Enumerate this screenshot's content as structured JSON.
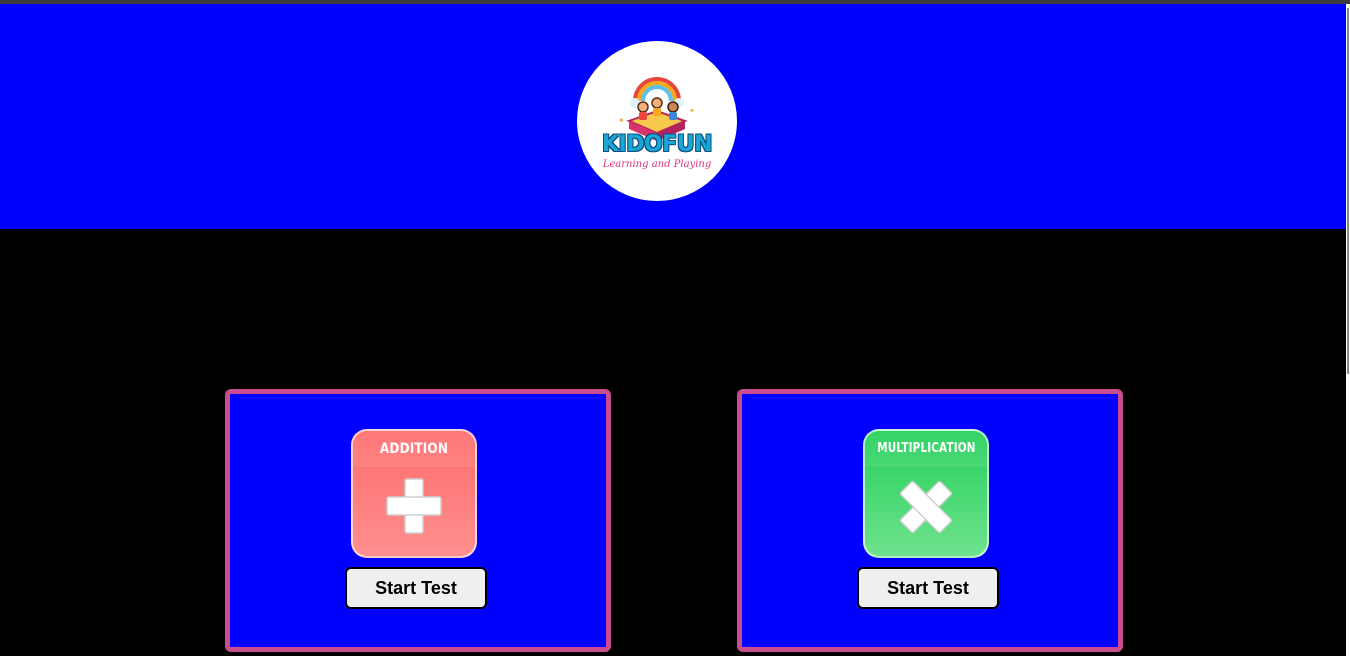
{
  "header": {
    "logo": {
      "title": "KIDOFUN",
      "subtitle": "Learning and Playing"
    }
  },
  "colors": {
    "header_bg": "#0000ff",
    "page_bg": "#000000",
    "card_bg": "#0000ff",
    "card_border": "#c94c8e",
    "addition_tile": "#ff7676",
    "multiplication_tile": "#2ed15e"
  },
  "cards": [
    {
      "label": "ADDITION",
      "icon": "plus-icon",
      "button_label": "Start Test"
    },
    {
      "label": "MULTIPLICATION",
      "icon": "multiply-icon",
      "button_label": "Start Test"
    }
  ]
}
